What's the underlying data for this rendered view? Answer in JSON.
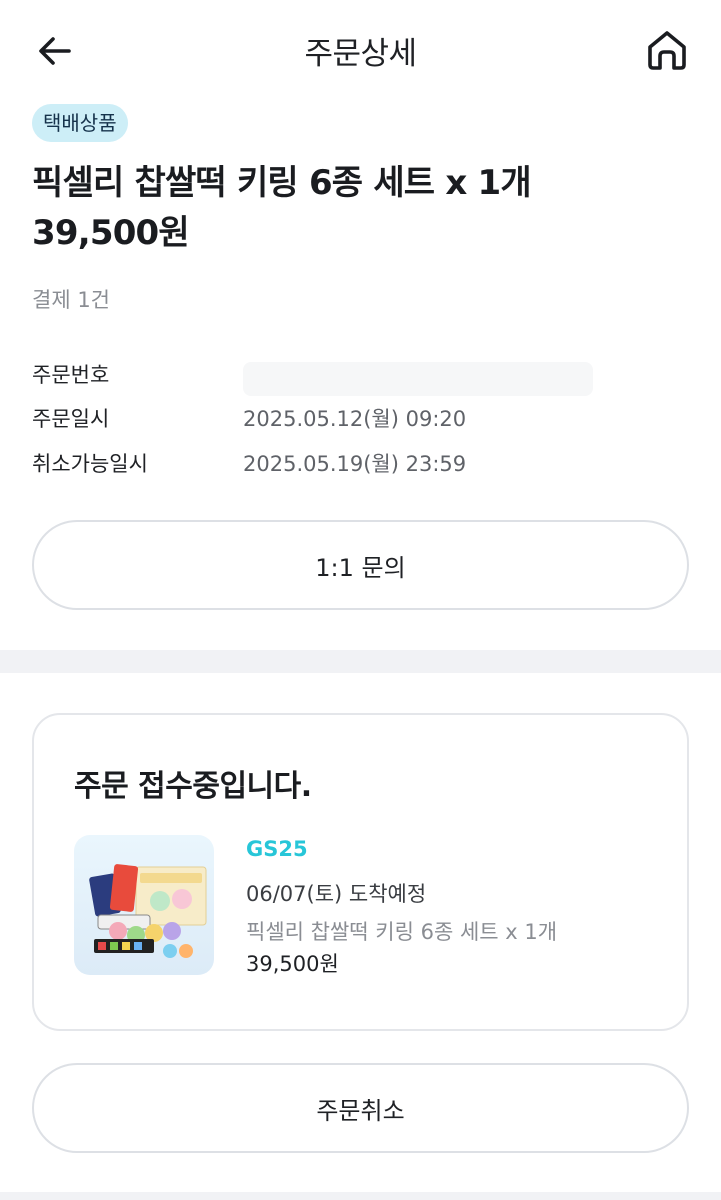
{
  "header": {
    "title": "주문상세",
    "back_icon": "arrow-left-icon",
    "home_icon": "home-icon"
  },
  "order": {
    "badge": "택배상품",
    "product_title": "픽셀리 찹쌀떡 키링 6종 세트 x 1개",
    "price": "39,500원",
    "payment_count": "결제 1건",
    "info": [
      {
        "label": "주문번호",
        "value": ""
      },
      {
        "label": "주문일시",
        "value": "2025.05.12(월) 09:20"
      },
      {
        "label": "취소가능일시",
        "value": "2025.05.19(월) 23:59"
      }
    ],
    "inquiry_label": "1:1 문의"
  },
  "status_card": {
    "title": "주문 접수중입니다.",
    "store": "GS25",
    "arrival": "06/07(토) 도착예정",
    "item_name": "픽셀리 찹쌀떡 키링 6종 세트 x 1개",
    "item_price": "39,500원"
  },
  "cancel_label": "주문취소",
  "colors": {
    "accent": "#27c6d8",
    "badge_bg": "#cdeef7",
    "divider": "#f1f2f5"
  }
}
